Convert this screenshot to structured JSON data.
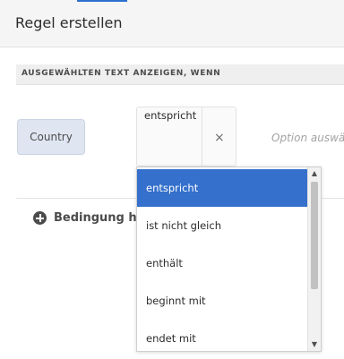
{
  "dialog": {
    "title": "Regel erstellen"
  },
  "section": {
    "label": "AUSGEWÄHLTEN TEXT ANZEIGEN, WENN"
  },
  "condition": {
    "field": "Country",
    "operator_value": "entspricht",
    "clear_symbol": "×",
    "option_placeholder": "Option auswähl"
  },
  "add_condition": {
    "label": "Bedingung hin"
  },
  "operator_options": [
    "entspricht",
    "ist nicht gleich",
    "enthält",
    "beginnt mit",
    "endet mit"
  ],
  "selected_index": 0,
  "colors": {
    "accent": "#2d6fce",
    "selected_option": "#3470cc",
    "chip_bg": "#dfe6f1"
  }
}
